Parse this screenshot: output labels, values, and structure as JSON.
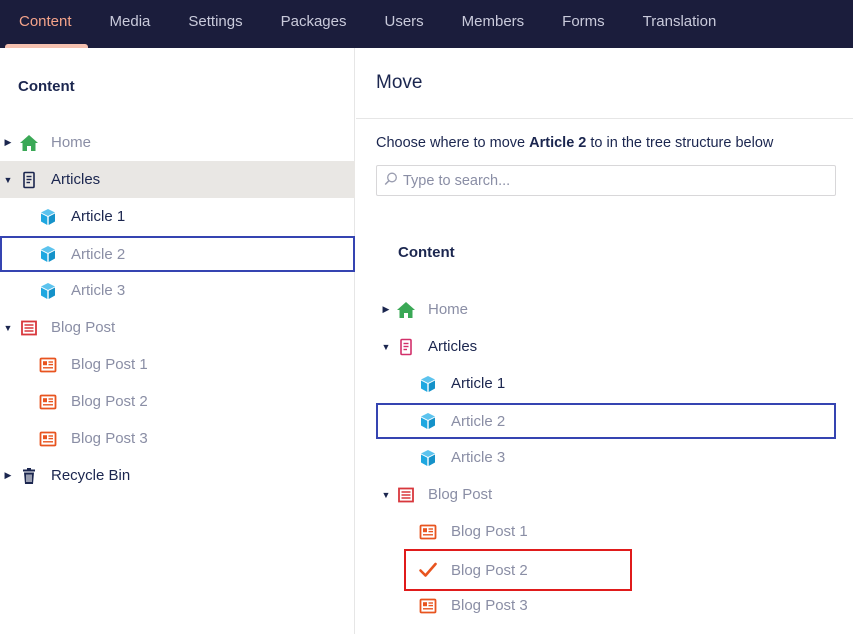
{
  "nav": {
    "tabs": [
      {
        "label": "Content",
        "active": true
      },
      {
        "label": "Media"
      },
      {
        "label": "Settings"
      },
      {
        "label": "Packages"
      },
      {
        "label": "Users"
      },
      {
        "label": "Members"
      },
      {
        "label": "Forms"
      },
      {
        "label": "Translation"
      }
    ]
  },
  "left_tree": {
    "title": "Content",
    "items": [
      {
        "label": "Home",
        "icon": "home-icon"
      },
      {
        "label": "Articles",
        "icon": "document-list-icon"
      },
      {
        "label": "Article 1",
        "icon": "cube-icon"
      },
      {
        "label": "Article 2",
        "icon": "cube-icon"
      },
      {
        "label": "Article 3",
        "icon": "cube-icon"
      },
      {
        "label": "Blog Post",
        "icon": "newspaper-icon"
      },
      {
        "label": "Blog Post 1",
        "icon": "newspaper-icon"
      },
      {
        "label": "Blog Post 2",
        "icon": "newspaper-icon"
      },
      {
        "label": "Blog Post 3",
        "icon": "newspaper-icon"
      },
      {
        "label": "Recycle Bin",
        "icon": "trash-icon"
      }
    ]
  },
  "move_panel": {
    "title": "Move",
    "instruction_pre": "Choose where to move ",
    "instruction_bold": "Article 2",
    "instruction_post": " to in the tree structure below",
    "search_placeholder": "Type to search...",
    "tree_title": "Content",
    "items": [
      {
        "label": "Home",
        "icon": "home-icon"
      },
      {
        "label": "Articles",
        "icon": "document-list-icon"
      },
      {
        "label": "Article 1",
        "icon": "cube-icon"
      },
      {
        "label": "Article 2",
        "icon": "cube-icon"
      },
      {
        "label": "Article 3",
        "icon": "cube-icon"
      },
      {
        "label": "Blog Post",
        "icon": "newspaper-icon"
      },
      {
        "label": "Blog Post 1",
        "icon": "newspaper-icon"
      },
      {
        "label": "Blog Post 2",
        "icon": "checkmark-icon"
      },
      {
        "label": "Blog Post 3",
        "icon": "newspaper-icon"
      }
    ]
  },
  "colors": {
    "nav_bg": "#1b1d3c",
    "active_tab": "#f4a38a",
    "selection_border": "#3544b1",
    "target_border": "#e01b1b",
    "home_green": "#3aa856",
    "cube_blue": "#1fa7e0",
    "blog_orange": "#e8541f"
  }
}
